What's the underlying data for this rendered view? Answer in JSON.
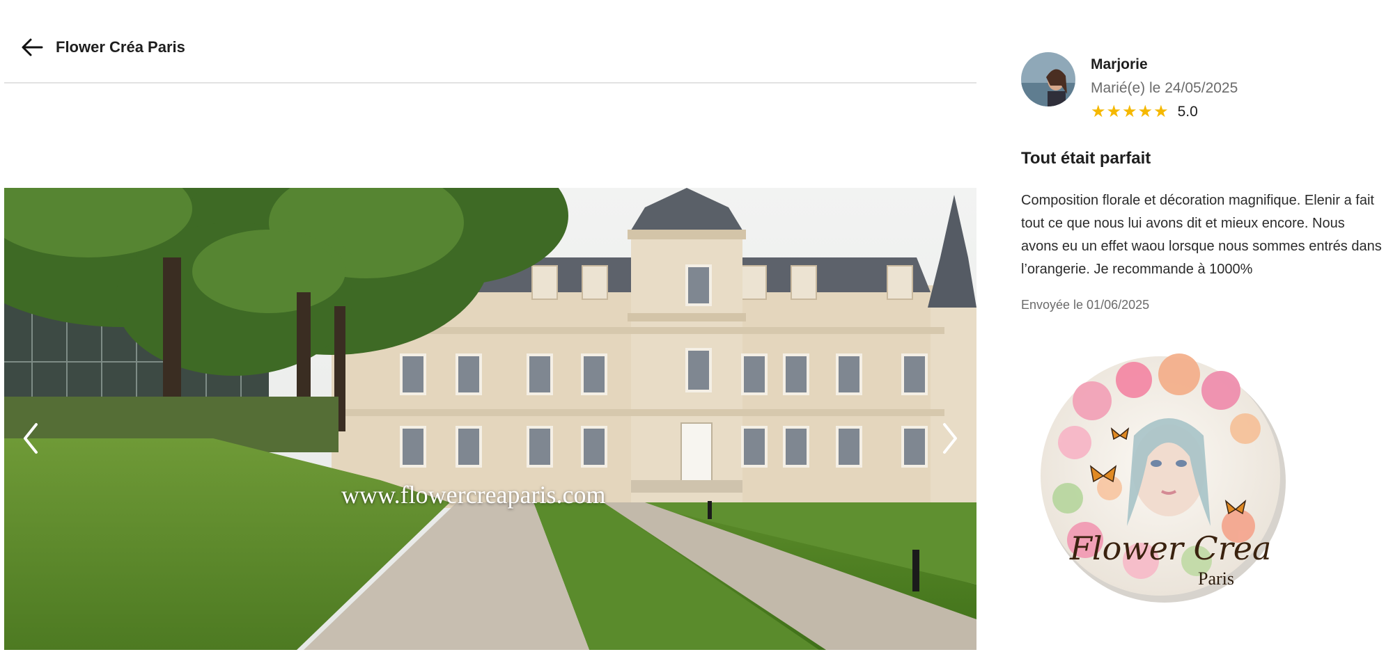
{
  "header": {
    "back_icon": "arrow-left-icon",
    "vendor_name": "Flower Créa Paris"
  },
  "gallery": {
    "watermark": "www.flowercreaparis.com",
    "prev_icon": "chevron-left-icon",
    "next_icon": "chevron-right-icon"
  },
  "review": {
    "reviewer_name": "Marjorie",
    "wedding_date": "Marié(e) le 24/05/2025",
    "stars": 5,
    "rating": "5.0",
    "title": "Tout était parfait",
    "body": "Composition florale et décoration magnifique. Elenir a fait tout ce que nous lui avons dit et mieux encore. Nous avons eu un effet waou lorsque nous sommes entrés dans l’orangerie. Je recommande à 1000%",
    "sent_date": "Envoyée le 01/06/2025"
  },
  "logo": {
    "line1": "Flower Crea",
    "line2": "Paris"
  },
  "colors": {
    "star": "#f5b800",
    "text": "#1e1e1e",
    "muted": "#6b6b6b",
    "divider": "#e2e2e2"
  }
}
